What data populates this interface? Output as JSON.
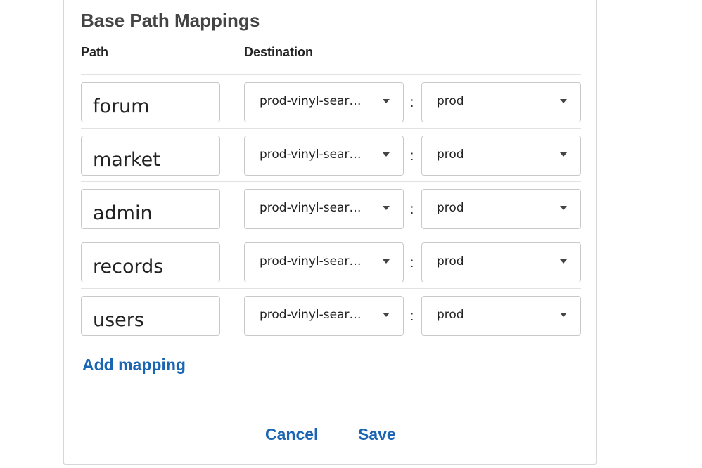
{
  "title": "Base Path Mappings",
  "columns": {
    "path": "Path",
    "destination": "Destination"
  },
  "mappings": [
    {
      "path": "forum",
      "api": "prod-vinyl-sear…",
      "separator": ":",
      "stage": "prod"
    },
    {
      "path": "market",
      "api": "prod-vinyl-sear…",
      "separator": ":",
      "stage": "prod"
    },
    {
      "path": "admin",
      "api": "prod-vinyl-sear…",
      "separator": ":",
      "stage": "prod"
    },
    {
      "path": "records",
      "api": "prod-vinyl-sear…",
      "separator": ":",
      "stage": "prod"
    },
    {
      "path": "users",
      "api": "prod-vinyl-sear…",
      "separator": ":",
      "stage": "prod"
    }
  ],
  "add_mapping_label": "Add mapping",
  "footer": {
    "cancel_label": "Cancel",
    "save_label": "Save"
  },
  "colors": {
    "link": "#1a66b3",
    "title": "#444444"
  },
  "icons": {
    "dropdown": "caret-down-icon"
  }
}
